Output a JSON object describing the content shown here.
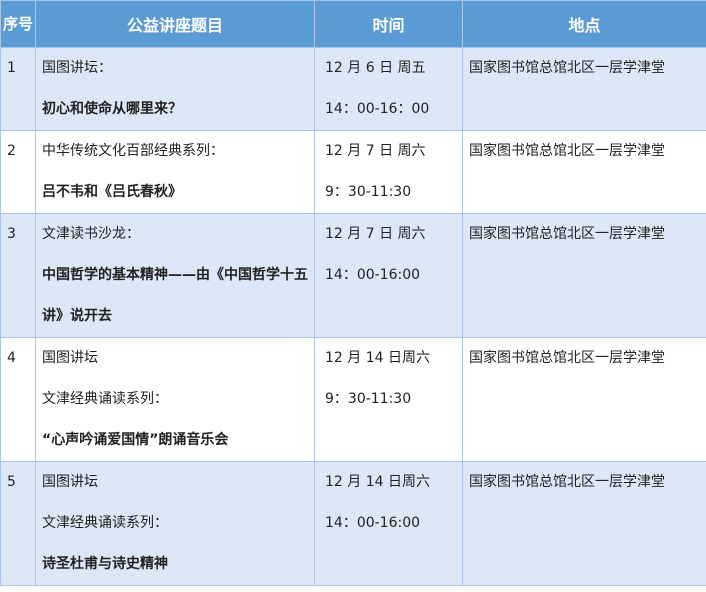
{
  "header": {
    "no": "序号",
    "title": "公益讲座题目",
    "time": "时间",
    "place": "地点"
  },
  "rows": [
    {
      "no": "1",
      "title": [
        {
          "text": "国图讲坛：",
          "bold": false
        },
        {
          "text": "初心和使命从哪里来？",
          "bold": true
        }
      ],
      "time": [
        "12 月 6 日 周五",
        "14：00-16：00"
      ],
      "place": "国家图书馆总馆北区一层学津堂"
    },
    {
      "no": "2",
      "title": [
        {
          "text": "中华传统文化百部经典系列：",
          "bold": false
        },
        {
          "text": "吕不韦和《吕氏春秋》",
          "bold": true
        }
      ],
      "time": [
        "12 月 7 日 周六",
        "9：30-11:30"
      ],
      "place": "国家图书馆总馆北区一层学津堂"
    },
    {
      "no": "3",
      "title": [
        {
          "text": "文津读书沙龙：",
          "bold": false
        },
        {
          "text": "中国哲学的基本精神——由《中国哲学十五讲》说开去",
          "bold": true,
          "wrap": true
        }
      ],
      "time": [
        "12 月 7 日 周六",
        " 14：00-16:00"
      ],
      "place": "国家图书馆总馆北区一层学津堂"
    },
    {
      "no": "4",
      "title": [
        {
          "text": "国图讲坛",
          "bold": false
        },
        {
          "text": "文津经典诵读系列：",
          "bold": false
        },
        {
          "text": "“心声吟诵爱国情”朗诵音乐会",
          "bold": true
        }
      ],
      "time": [
        "12 月 14 日周六",
        "9：30-11:30"
      ],
      "place": "国家图书馆总馆北区一层学津堂"
    },
    {
      "no": "5",
      "title": [
        {
          "text": "国图讲坛",
          "bold": false
        },
        {
          "text": "文津经典诵读系列：",
          "bold": false
        },
        {
          "text": "诗圣杜甫与诗史精神",
          "bold": true
        }
      ],
      "time": [
        "12 月 14 日周六",
        "14：00-16:00"
      ],
      "place": "国家图书馆总馆北区一层学津堂"
    }
  ]
}
